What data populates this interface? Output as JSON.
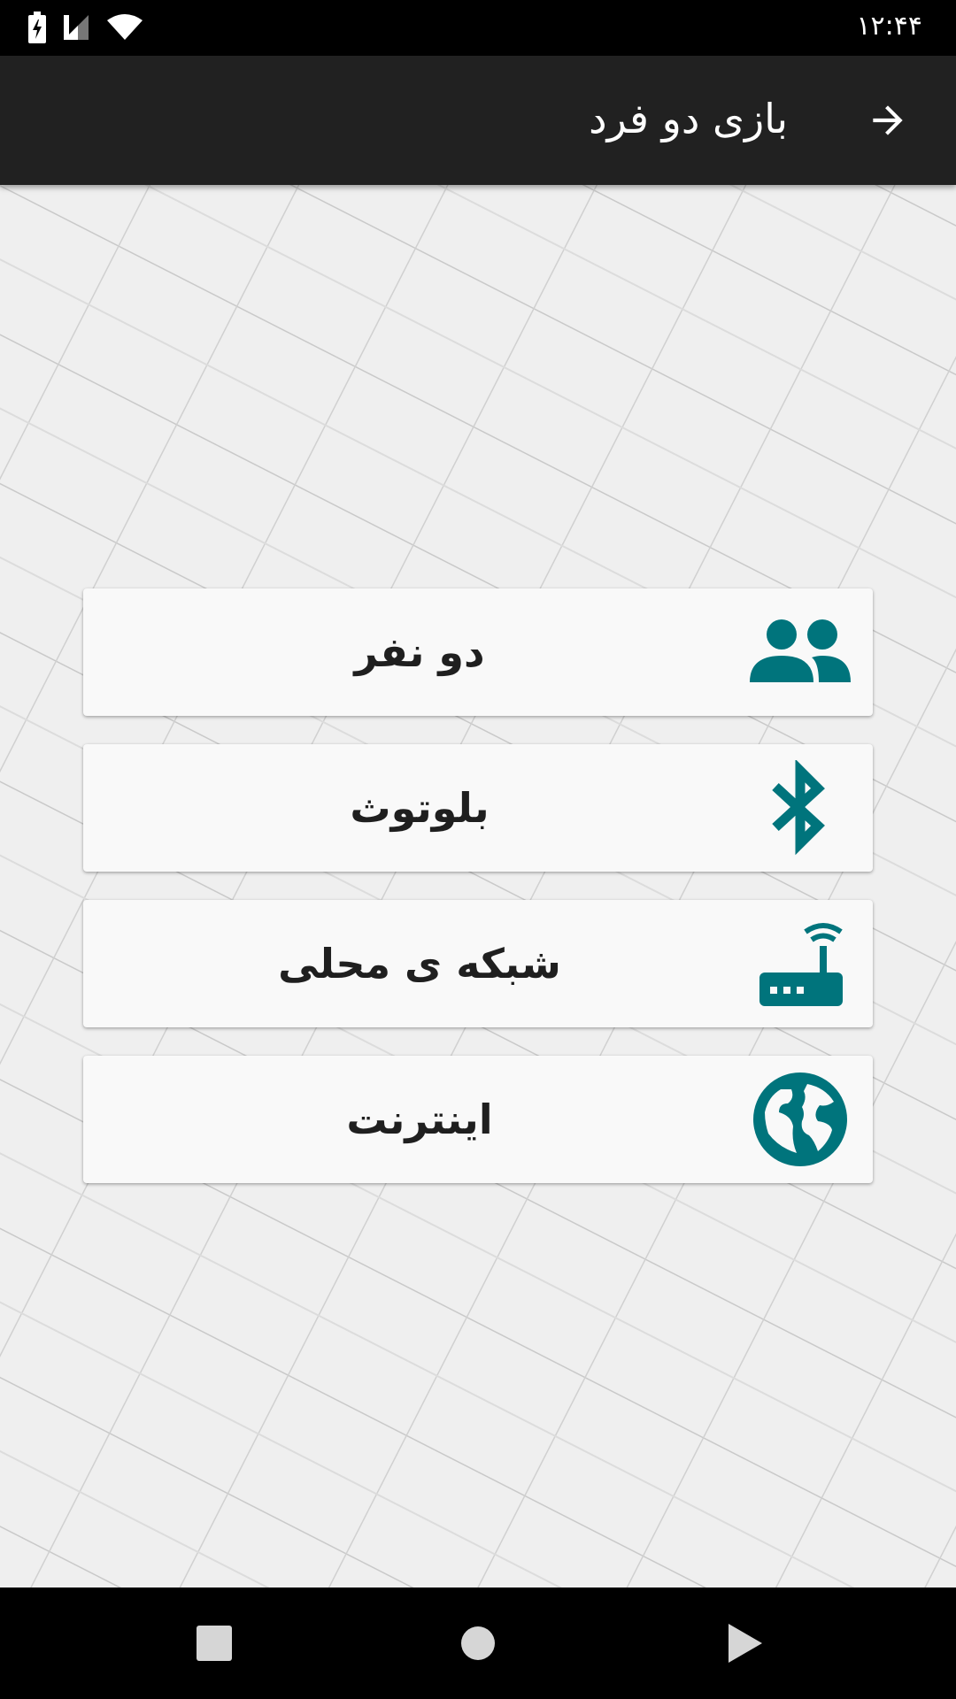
{
  "status_bar": {
    "time": "۱۲:۴۴",
    "icons": [
      "battery-charging-icon",
      "cell-signal-icon",
      "wifi-icon"
    ]
  },
  "app_bar": {
    "title": "بازی دو فرد",
    "back_icon": "arrow-forward-icon"
  },
  "menu": {
    "items": [
      {
        "label": "دو نفر",
        "icon": "people-icon"
      },
      {
        "label": "بلوتوث",
        "icon": "bluetooth-icon"
      },
      {
        "label": "شبکه ی محلی",
        "icon": "router-icon"
      },
      {
        "label": "اینترنت",
        "icon": "globe-icon"
      }
    ]
  },
  "nav_bar": {
    "buttons": [
      "recents-square-icon",
      "home-circle-icon",
      "back-triangle-icon"
    ]
  },
  "colors": {
    "accent": "#00747c",
    "app_bar": "#212121",
    "card": "#f9f9f9",
    "background": "#efefef"
  }
}
